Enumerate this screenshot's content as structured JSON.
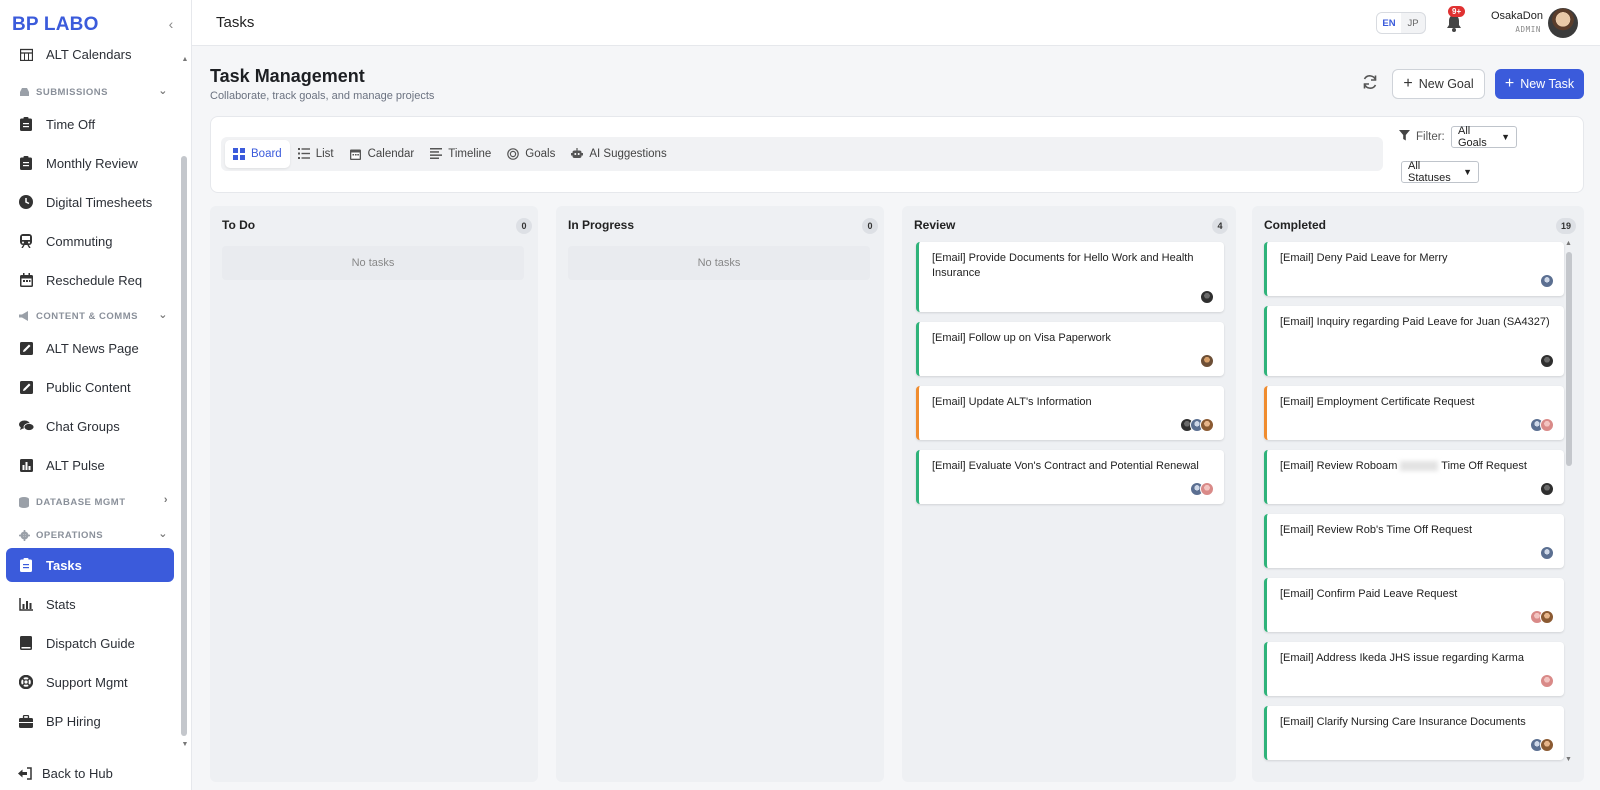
{
  "app": {
    "brand": "BP LABO",
    "page_header": "Tasks"
  },
  "sidebar": {
    "collapse_icon": "chevron-left-icon",
    "cut_item": "ALT Calendars",
    "sections": {
      "submissions": "SUBMISSIONS",
      "content": "CONTENT & COMMS",
      "database": "DATABASE MGMT",
      "operations": "OPERATIONS"
    },
    "items": {
      "time_off": "Time Off",
      "monthly_review": "Monthly Review",
      "digital_timesheets": "Digital Timesheets",
      "commuting": "Commuting",
      "reschedule": "Reschedule Req",
      "news": "ALT News Page",
      "public_content": "Public Content",
      "chat_groups": "Chat Groups",
      "alt_pulse": "ALT Pulse",
      "tasks": "Tasks",
      "stats": "Stats",
      "dispatch": "Dispatch Guide",
      "support": "Support Mgmt",
      "hiring": "BP Hiring"
    },
    "back_to_hub": "Back to Hub"
  },
  "header": {
    "lang_en": "EN",
    "lang_jp": "JP",
    "notif_badge": "9+",
    "user_name": "OsakaDon",
    "user_role": "ADMIN"
  },
  "page": {
    "title": "Task Management",
    "subtitle": "Collaborate, track goals, and manage projects",
    "new_goal": "New Goal",
    "new_task": "New Task"
  },
  "views": {
    "board": "Board",
    "list": "List",
    "calendar": "Calendar",
    "timeline": "Timeline",
    "goals": "Goals",
    "ai": "AI Suggestions"
  },
  "filters": {
    "label": "Filter:",
    "goals_value": "All Goals",
    "status_value": "All Statuses"
  },
  "board": {
    "todo": {
      "title": "To Do",
      "count": "0",
      "empty": "No tasks"
    },
    "inprogress": {
      "title": "In Progress",
      "count": "0",
      "empty": "No tasks"
    },
    "review": {
      "title": "Review",
      "count": "4",
      "cards": [
        "[Email] Provide Documents for Hello Work and Health Insurance",
        "[Email] Follow up on Visa Paperwork",
        "[Email] Update ALT's Information",
        "[Email] Evaluate Von's Contract and Potential Renewal"
      ]
    },
    "completed": {
      "title": "Completed",
      "count": "19",
      "cards": [
        "[Email] Deny Paid Leave for Merry",
        "[Email] Inquiry regarding Paid Leave for Juan (SA4327)",
        "[Email] Employment Certificate Request",
        "[Email] Review Roboam",
        "Time Off Request",
        "[Email] Review Rob's Time Off Request",
        "[Email] Confirm Paid Leave Request",
        "[Email] Address Ikeda JHS issue regarding Karma",
        "[Email] Clarify Nursing Care Insurance Documents"
      ]
    }
  }
}
